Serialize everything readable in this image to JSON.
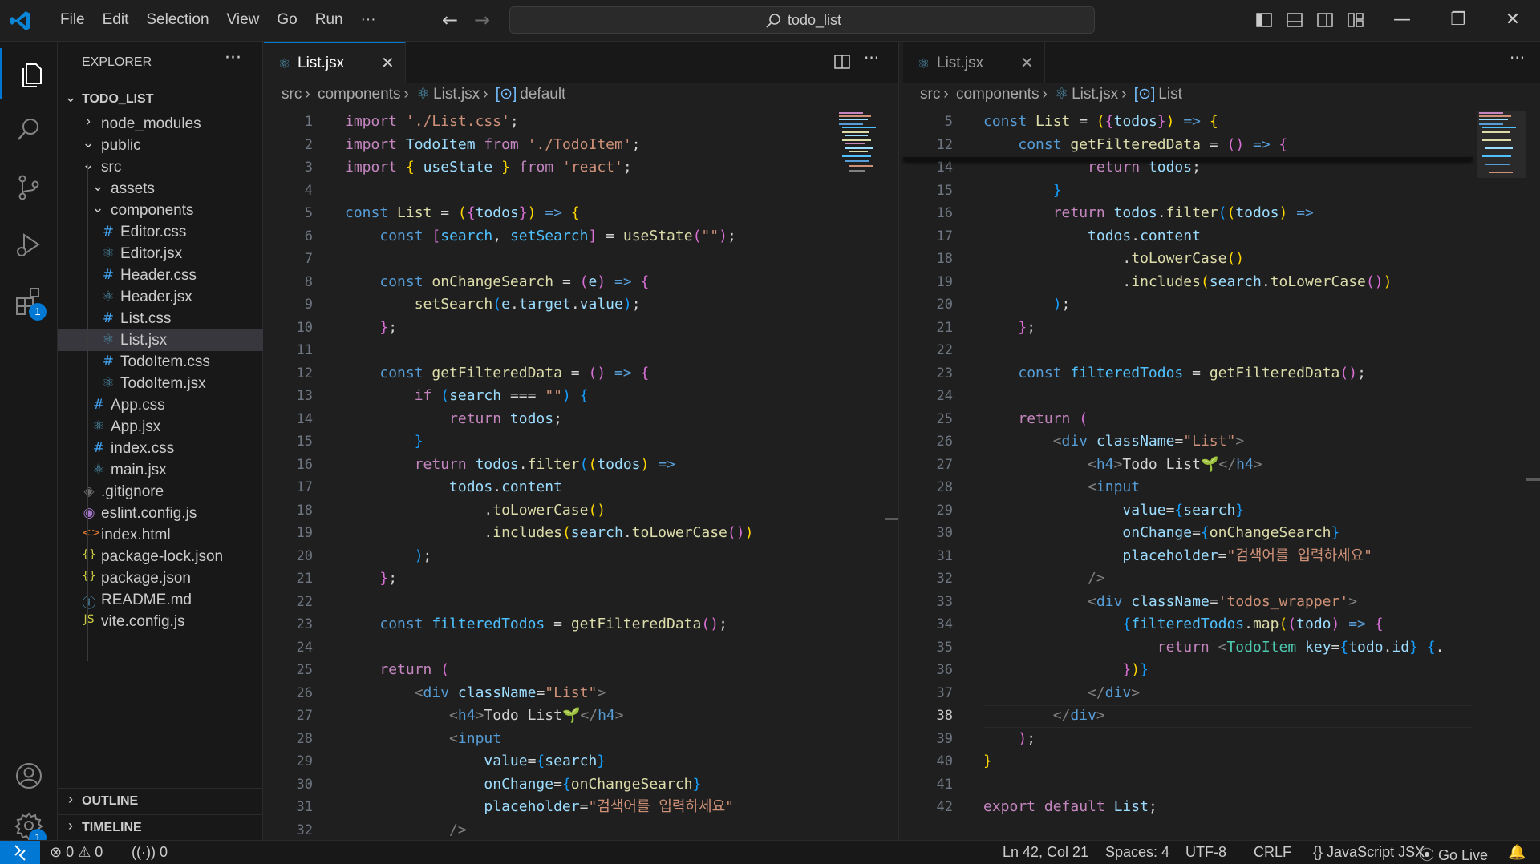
{
  "menu": [
    "File",
    "Edit",
    "Selection",
    "View",
    "Go",
    "Run",
    "···"
  ],
  "search": {
    "text": "todo_list"
  },
  "activity_badges": {
    "extensions": "1",
    "settings": "1"
  },
  "sidebar": {
    "title": "EXPLORER",
    "more": "···",
    "project": "TODO_LIST",
    "items": [
      {
        "label": "node_modules",
        "icon": "chevron-right",
        "indent": 1
      },
      {
        "label": "public",
        "icon": "chevron-down",
        "indent": 1
      },
      {
        "label": "src",
        "icon": "chevron-down",
        "indent": 1
      },
      {
        "label": "assets",
        "icon": "chevron-down",
        "indent": 2
      },
      {
        "label": "components",
        "icon": "chevron-down",
        "indent": 2
      },
      {
        "label": "Editor.css",
        "icon": "css",
        "indent": 3
      },
      {
        "label": "Editor.jsx",
        "icon": "react",
        "indent": 3
      },
      {
        "label": "Header.css",
        "icon": "css",
        "indent": 3
      },
      {
        "label": "Header.jsx",
        "icon": "react",
        "indent": 3
      },
      {
        "label": "List.css",
        "icon": "css",
        "indent": 3
      },
      {
        "label": "List.jsx",
        "icon": "react",
        "indent": 3,
        "selected": true
      },
      {
        "label": "TodoItem.css",
        "icon": "css",
        "indent": 3
      },
      {
        "label": "TodoItem.jsx",
        "icon": "react",
        "indent": 3
      },
      {
        "label": "App.css",
        "icon": "css",
        "indent": 2
      },
      {
        "label": "App.jsx",
        "icon": "react",
        "indent": 2
      },
      {
        "label": "index.css",
        "icon": "css",
        "indent": 2
      },
      {
        "label": "main.jsx",
        "icon": "react",
        "indent": 2
      },
      {
        "label": ".gitignore",
        "icon": "git",
        "indent": 1
      },
      {
        "label": "eslint.config.js",
        "icon": "eslint",
        "indent": 1
      },
      {
        "label": "index.html",
        "icon": "html",
        "indent": 1
      },
      {
        "label": "package-lock.json",
        "icon": "json",
        "indent": 1
      },
      {
        "label": "package.json",
        "icon": "json",
        "indent": 1
      },
      {
        "label": "README.md",
        "icon": "info",
        "indent": 1
      },
      {
        "label": "vite.config.js",
        "icon": "js",
        "indent": 1
      }
    ],
    "outline": "OUTLINE",
    "timeline": "TIMELINE"
  },
  "left_editor": {
    "tab": "List.jsx",
    "breadcrumb": [
      "src",
      "components",
      "List.jsx",
      "default"
    ]
  },
  "right_editor": {
    "tab": "List.jsx",
    "breadcrumb": [
      "src",
      "components",
      "List.jsx",
      "List"
    ]
  },
  "code_left": {
    "line_numbers": [
      "1",
      "2",
      "3",
      "4",
      "5",
      "6",
      "7",
      "8",
      "9",
      "10",
      "11",
      "12",
      "13",
      "14",
      "15",
      "16",
      "17",
      "18",
      "19",
      "20",
      "21",
      "22",
      "23",
      "24",
      "25",
      "26",
      "27",
      "28",
      "29",
      "30",
      "31",
      "32"
    ]
  },
  "code_right": {
    "line_numbers": [
      "5",
      "12",
      "14",
      "15",
      "16",
      "17",
      "18",
      "19",
      "20",
      "21",
      "22",
      "23",
      "24",
      "25",
      "26",
      "27",
      "28",
      "29",
      "30",
      "31",
      "32",
      "33",
      "34",
      "35",
      "36",
      "37",
      "38",
      "39",
      "40",
      "41",
      "42"
    ],
    "current_line": "38"
  },
  "statusbar": {
    "errors": "0",
    "warnings": "0",
    "ports": "0",
    "position": "Ln 42, Col 21",
    "spaces": "Spaces: 4",
    "encoding": "UTF-8",
    "eol": "CRLF",
    "language": "JavaScript JSX",
    "golive": "Go Live",
    "braces": "{}"
  }
}
